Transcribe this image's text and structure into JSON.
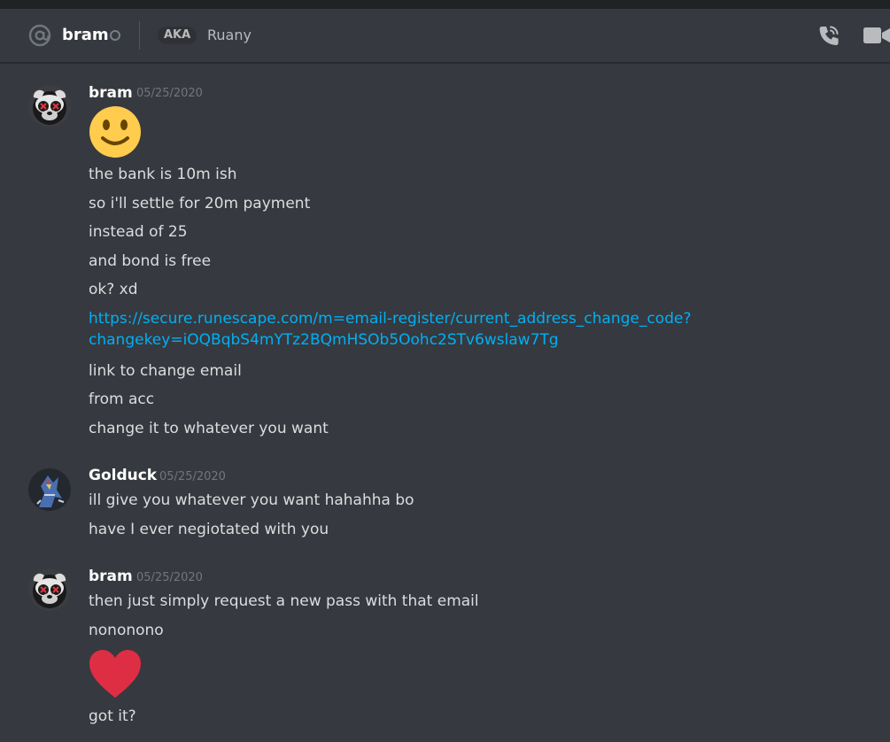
{
  "header": {
    "recipient": "bram",
    "aka_label": "AKA",
    "aka_name": "Ruany"
  },
  "icons": {
    "at": "at-icon",
    "status": "status-offline-icon",
    "call": "phone-call-icon",
    "video": "video-camera-icon",
    "emoji_smile": "slightly-smiling-face-icon",
    "emoji_heart": "red-heart-icon"
  },
  "colors": {
    "background": "#36393f",
    "link": "#00b0f4",
    "heart": "#dd2e44",
    "smile": "#ffcc4d"
  },
  "messages": [
    {
      "author": "bram",
      "timestamp": "05/25/2020",
      "lines": [
        "the bank is 10m ish",
        "so i'll settle for 20m payment",
        "instead of 25",
        "and bond is free",
        "ok? xd"
      ],
      "link": [
        "https://secure.runescape.com/m=email-register/current_address_change_code?",
        "changekey=iOQBqbS4mYTz2BQmHSOb5Oohc2STv6wslaw7Tg"
      ],
      "after_link": [
        "link to change email",
        "from acc",
        "change it to whatever you want"
      ]
    },
    {
      "author": "Golduck",
      "timestamp": "05/25/2020",
      "lines": [
        "ill give you whatever you want hahahha bo",
        "have I ever negiotated with you"
      ]
    },
    {
      "author": "bram",
      "timestamp": "05/25/2020",
      "lines": [
        "then just simply request a new pass with that email",
        "nononono"
      ],
      "after_emoji": [
        "got it?"
      ]
    }
  ]
}
